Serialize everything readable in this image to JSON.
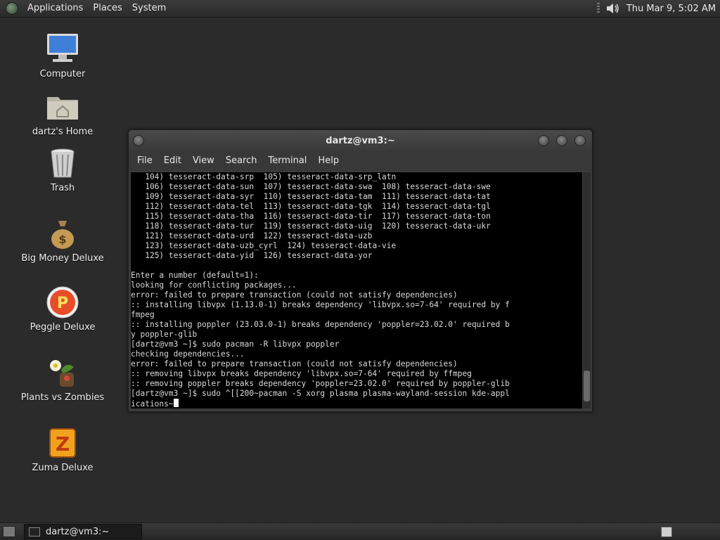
{
  "top_panel": {
    "menus": [
      "Applications",
      "Places",
      "System"
    ],
    "clock": "Thu Mar  9,  5:02 AM"
  },
  "desktop": {
    "icons": [
      {
        "label": "Computer",
        "icon": "computer-icon"
      },
      {
        "label": "dartz's Home",
        "icon": "home-folder-icon"
      },
      {
        "label": "Trash",
        "icon": "trash-icon"
      },
      {
        "label": "Big Money Deluxe",
        "icon": "money-bag-icon"
      },
      {
        "label": "Peggle Deluxe",
        "icon": "peggle-icon"
      },
      {
        "label": "Plants vs Zombies",
        "icon": "plant-icon"
      },
      {
        "label": "Zuma Deluxe",
        "icon": "zuma-icon"
      }
    ]
  },
  "terminal": {
    "title": "dartz@vm3:~",
    "menu": [
      "File",
      "Edit",
      "View",
      "Search",
      "Terminal",
      "Help"
    ],
    "lines": [
      "   104) tesseract-data-srp  105) tesseract-data-srp_latn",
      "   106) tesseract-data-sun  107) tesseract-data-swa  108) tesseract-data-swe",
      "   109) tesseract-data-syr  110) tesseract-data-tam  111) tesseract-data-tat",
      "   112) tesseract-data-tel  113) tesseract-data-tgk  114) tesseract-data-tgl",
      "   115) tesseract-data-tha  116) tesseract-data-tir  117) tesseract-data-ton",
      "   118) tesseract-data-tur  119) tesseract-data-uig  120) tesseract-data-ukr",
      "   121) tesseract-data-urd  122) tesseract-data-uzb",
      "   123) tesseract-data-uzb_cyrl  124) tesseract-data-vie",
      "   125) tesseract-data-yid  126) tesseract-data-yor",
      "",
      "Enter a number (default=1):",
      "looking for conflicting packages...",
      "error: failed to prepare transaction (could not satisfy dependencies)",
      ":: installing libvpx (1.13.0-1) breaks dependency 'libvpx.so=7-64' required by f",
      "fmpeg",
      ":: installing poppler (23.03.0-1) breaks dependency 'poppler=23.02.0' required b",
      "y poppler-glib",
      "[dartz@vm3 ~]$ sudo pacman -R libvpx poppler",
      "checking dependencies...",
      "error: failed to prepare transaction (could not satisfy dependencies)",
      ":: removing libvpx breaks dependency 'libvpx.so=7-64' required by ffmpeg",
      ":: removing poppler breaks dependency 'poppler=23.02.0' required by poppler-glib",
      "[dartz@vm3 ~]$ sudo ^[[200~pacman -S xorg plasma plasma-wayland-session kde-appl",
      "ications~"
    ]
  },
  "bottom_panel": {
    "task_label": "dartz@vm3:~"
  }
}
